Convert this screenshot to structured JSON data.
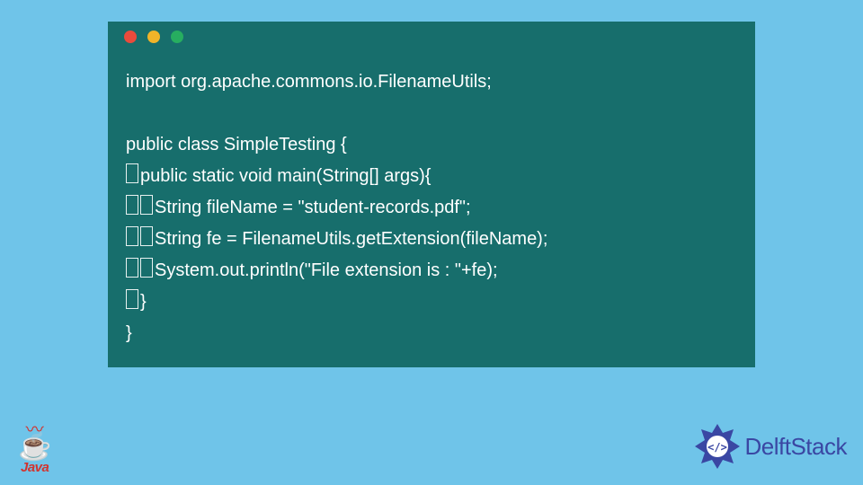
{
  "window": {
    "dots": {
      "red": "#e94b3c",
      "yellow": "#f0b429",
      "green": "#27ae60"
    },
    "bg": "#176e6c"
  },
  "code": {
    "l1": "import org.apache.commons.io.FilenameUtils;",
    "l2": "",
    "l3": "public class SimpleTesting {",
    "l4": "public static void main(String[] args){",
    "l5": "String fileName = \"student-records.pdf\";",
    "l6": "String fe = FilenameUtils.getExtension(fileName);",
    "l7": "System.out.println(\"File extension is : \"+fe);",
    "l8": "}",
    "l9": "}"
  },
  "logos": {
    "java_label": "Java",
    "delft_label": "DelftStack"
  },
  "colors": {
    "page_bg": "#6fc4e9",
    "code_fg": "#ffffff",
    "delft_blue": "#3a47a3"
  }
}
